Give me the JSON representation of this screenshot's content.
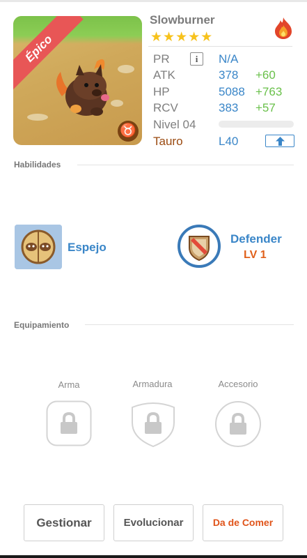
{
  "hero": {
    "name": "Slowburner",
    "stars": "★★★★★",
    "rarity_ribbon": "Épico",
    "zodiac_glyph": "♉",
    "element_icon": "fire-icon"
  },
  "stats": {
    "pr": {
      "label": "PR",
      "value": "N/A"
    },
    "atk": {
      "label": "ATK",
      "value": "378",
      "bonus": "+60"
    },
    "hp": {
      "label": "HP",
      "value": "5088",
      "bonus": "+763"
    },
    "rcv": {
      "label": "RCV",
      "value": "383",
      "bonus": "+57"
    },
    "nivel": {
      "label": "Nivel 04",
      "progress": 0
    },
    "sign": {
      "label": "Tauro",
      "value": "L40"
    }
  },
  "sections": {
    "skills_title": "Habilidades",
    "equipment_title": "Equipamiento"
  },
  "skills": [
    {
      "name": "Espejo",
      "icon": "mirror-skill-icon"
    },
    {
      "name": "Defender",
      "level": "LV 1",
      "icon": "shield-skill-icon"
    }
  ],
  "equipment": [
    {
      "label": "Arma",
      "icon": "lock-icon"
    },
    {
      "label": "Armadura",
      "icon": "lock-icon"
    },
    {
      "label": "Accesorio",
      "icon": "lock-icon"
    }
  ],
  "actions": {
    "manage": "Gestionar",
    "evolve": "Evolucionar",
    "feed": "Da de Comer"
  },
  "colors": {
    "stat_value": "#3a86c8",
    "stat_bonus": "#69c04a",
    "sign_label": "#9a4a10",
    "feed_button": "#e0541a",
    "ribbon": "#e85656"
  }
}
